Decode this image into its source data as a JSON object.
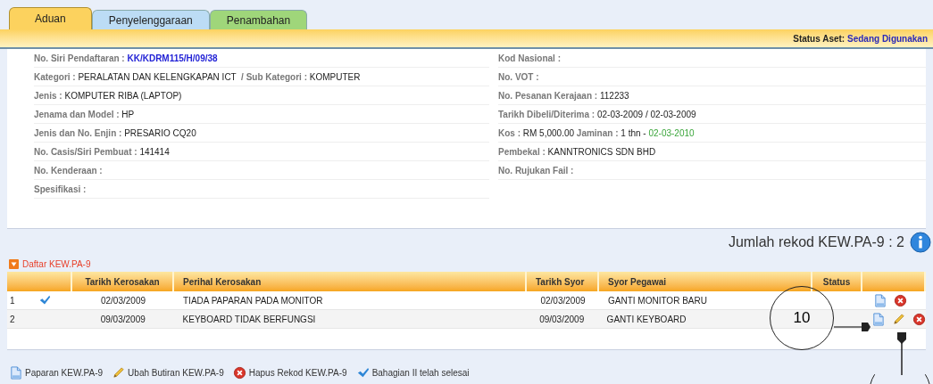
{
  "tabs": [
    {
      "label": "Aduan",
      "selected": true,
      "color": "#fcd25e"
    },
    {
      "label": "Penyelenggaraan",
      "selected": false,
      "color": "#bcdcf5"
    },
    {
      "label": "Penambahan",
      "selected": false,
      "color": "#9fd67a"
    }
  ],
  "status_aset": {
    "label": "Status Aset:",
    "value": "Sedang Digunakan"
  },
  "details": {
    "left": [
      [
        {
          "kind": "label",
          "text": "No. Siri Pendaftaran : "
        },
        {
          "kind": "link",
          "text": "KK/KDRM115/H/09/38"
        }
      ],
      [
        {
          "kind": "label",
          "text": "Kategori : "
        },
        {
          "kind": "value",
          "text": "PERALATAN DAN KELENGKAPAN ICT "
        },
        {
          "kind": "label",
          "text": " / Sub Kategori : "
        },
        {
          "kind": "value",
          "text": "KOMPUTER"
        }
      ],
      [
        {
          "kind": "label",
          "text": "Jenis : "
        },
        {
          "kind": "value",
          "text": "KOMPUTER RIBA (LAPTOP)"
        }
      ],
      [
        {
          "kind": "label",
          "text": "Jenama dan Model : "
        },
        {
          "kind": "value",
          "text": "HP"
        }
      ],
      [
        {
          "kind": "label",
          "text": "Jenis dan No. Enjin : "
        },
        {
          "kind": "value",
          "text": "PRESARIO CQ20"
        }
      ],
      [
        {
          "kind": "label",
          "text": "No. Casis/Siri Pembuat : "
        },
        {
          "kind": "value",
          "text": "141414"
        }
      ],
      [
        {
          "kind": "label",
          "text": "No. Kenderaan :"
        }
      ],
      [
        {
          "kind": "label",
          "text": "Spesifikasi :"
        }
      ]
    ],
    "right": [
      [
        {
          "kind": "label",
          "text": "Kod Nasional :"
        }
      ],
      [
        {
          "kind": "label",
          "text": "No. VOT :"
        }
      ],
      [
        {
          "kind": "label",
          "text": "No. Pesanan Kerajaan : "
        },
        {
          "kind": "value",
          "text": "112233"
        }
      ],
      [
        {
          "kind": "label",
          "text": "Tarikh Dibeli/Diterima : "
        },
        {
          "kind": "value",
          "text": "02-03-2009 / 02-03-2009"
        }
      ],
      [
        {
          "kind": "label",
          "text": "Kos : "
        },
        {
          "kind": "value",
          "text": "RM 5,000.00 "
        },
        {
          "kind": "label",
          "text": "Jaminan : "
        },
        {
          "kind": "value",
          "text": "1 thn - "
        },
        {
          "kind": "green",
          "text": "02-03-2010"
        }
      ],
      [
        {
          "kind": "label",
          "text": "Pembekal : "
        },
        {
          "kind": "value",
          "text": "KANNTRONICS SDN BHD"
        }
      ],
      [
        {
          "kind": "label",
          "text": "No. Rujukan Fail :"
        }
      ]
    ]
  },
  "record_count": {
    "label": "Jumlah rekod KEW.PA-9 :",
    "value": "2"
  },
  "section": {
    "title": "Daftar KEW.PA-9",
    "expanded": true
  },
  "table": {
    "columns": [
      "Tarikh Kerosakan",
      "Perihal Kerosakan",
      "Tarikh Syor",
      "Syor Pegawai",
      "Status"
    ],
    "rows": [
      {
        "no": "1",
        "done": true,
        "cells": [
          "02/03/2009",
          "TIADA PAPARAN PADA MONITOR",
          "02/03/2009",
          "GANTI MONITOR BARU"
        ],
        "actions": [
          {
            "kind": "view"
          },
          {
            "kind": "delete"
          }
        ]
      },
      {
        "no": "2",
        "done": false,
        "cells": [
          "09/03/2009",
          "KEYBOARD TIDAK BERFUNGSI",
          "09/03/2009",
          "GANTI KEYBOARD"
        ],
        "actions": [
          {
            "kind": "view"
          },
          {
            "kind": "edit"
          },
          {
            "kind": "delete"
          }
        ]
      }
    ]
  },
  "legend": [
    {
      "kind": "view",
      "text": "Paparan KEW.PA-9"
    },
    {
      "kind": "edit",
      "text": "Ubah Butiran KEW.PA-9"
    },
    {
      "kind": "delete",
      "text": "Hapus Rekod KEW.PA-9"
    },
    {
      "kind": "done",
      "text": "Bahagian II telah selesai"
    }
  ],
  "callouts": [
    {
      "label": "10"
    }
  ]
}
